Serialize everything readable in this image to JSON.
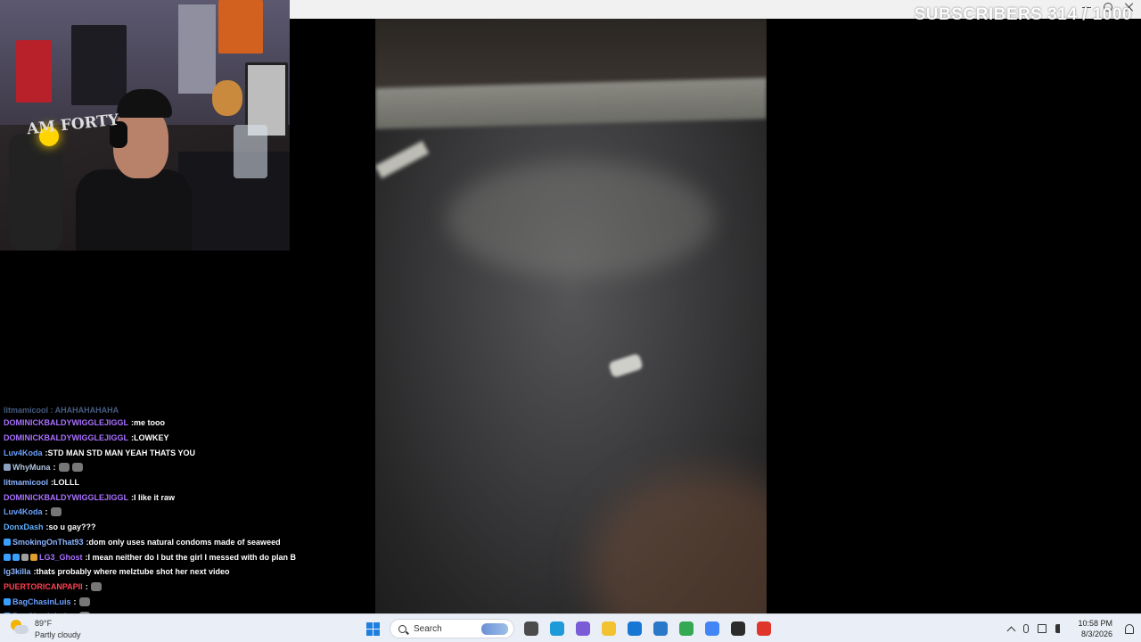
{
  "overlay": {
    "subscriber_goal": "SUBSCRIBERS 314 / 1000"
  },
  "webcam": {
    "shirt_text": "AM FORTY"
  },
  "chat": {
    "partial_top": "litmamicool : AHAHAHAHAHA",
    "messages": [
      {
        "user": "DOMINICKBALDYWIGGLEJIGGL",
        "color": "#a970ff",
        "text": "me tooo",
        "badges": [],
        "emotes": 0
      },
      {
        "user": "DOMINICKBALDYWIGGLEJIGGL",
        "color": "#a970ff",
        "text": "LOWKEY",
        "badges": [],
        "emotes": 0
      },
      {
        "user": "Luv4Koda",
        "color": "#6aa0ff",
        "text": "STD MAN STD MAN YEAH THATS YOU",
        "badges": [],
        "emotes": 0
      },
      {
        "user": "WhyMuna",
        "color": "#b0c4de",
        "text": "",
        "badges": [
          "#8aa0c0"
        ],
        "emotes": 2
      },
      {
        "user": "litmamicool",
        "color": "#8ab4ff",
        "text": "LOLLL",
        "badges": [],
        "emotes": 0
      },
      {
        "user": "DOMINICKBALDYWIGGLEJIGGL",
        "color": "#a970ff",
        "text": "I like it raw",
        "badges": [],
        "emotes": 0
      },
      {
        "user": "Luv4Koda",
        "color": "#6aa0ff",
        "text": "",
        "badges": [],
        "emotes": 1
      },
      {
        "user": "DonxDash",
        "color": "#5fb0ff",
        "text": "so u gay???",
        "badges": [],
        "emotes": 0
      },
      {
        "user": "SmokingOnThat93",
        "color": "#8ab4ff",
        "text": "dom only uses natural condoms made of seaweed",
        "badges": [
          "#3aa0ff"
        ],
        "emotes": 0
      },
      {
        "user": "LG3_Ghost",
        "color": "#a970ff",
        "text": "I mean neither do I but the girl I messed with do plan B",
        "badges": [
          "#3aa0ff",
          "#3aa0ff",
          "#a0a0a0",
          "#e0a030"
        ],
        "emotes": 0
      },
      {
        "user": "lg3killa",
        "color": "#8ab4ff",
        "text": "thats probably where melztube shot her next video",
        "badges": [],
        "emotes": 0
      },
      {
        "user": "PUERTORICANPAPII",
        "color": "#ff4050",
        "text": "",
        "badges": [],
        "emotes": 1
      },
      {
        "user": "BagChasinLuis",
        "color": "#6aa0ff",
        "text": "",
        "badges": [
          "#3aa0ff"
        ],
        "emotes": 1
      },
      {
        "user": "BagChasinLuis",
        "color": "#6aa0ff",
        "text": "",
        "badges": [
          "#3aa0ff"
        ],
        "emotes": 1
      }
    ]
  },
  "taskbar": {
    "weather_temp": "89°F",
    "weather_desc": "Partly cloudy",
    "search_placeholder": "Search",
    "apps": [
      {
        "name": "file-explorer",
        "color": "#4b4b4b"
      },
      {
        "name": "edge",
        "color": "#1d9bd8"
      },
      {
        "name": "copilot",
        "color": "#7a5cd6"
      },
      {
        "name": "folder",
        "color": "#f2c230"
      },
      {
        "name": "store",
        "color": "#1778d4"
      },
      {
        "name": "outlook",
        "color": "#2a78c8"
      },
      {
        "name": "chrome",
        "color": "#34a853"
      },
      {
        "name": "chrome-2",
        "color": "#4285f4"
      },
      {
        "name": "obs",
        "color": "#2b2b2b"
      },
      {
        "name": "streaming-app",
        "color": "#e0352b"
      }
    ],
    "time": "10:58 PM",
    "date": "8/3/2026"
  }
}
